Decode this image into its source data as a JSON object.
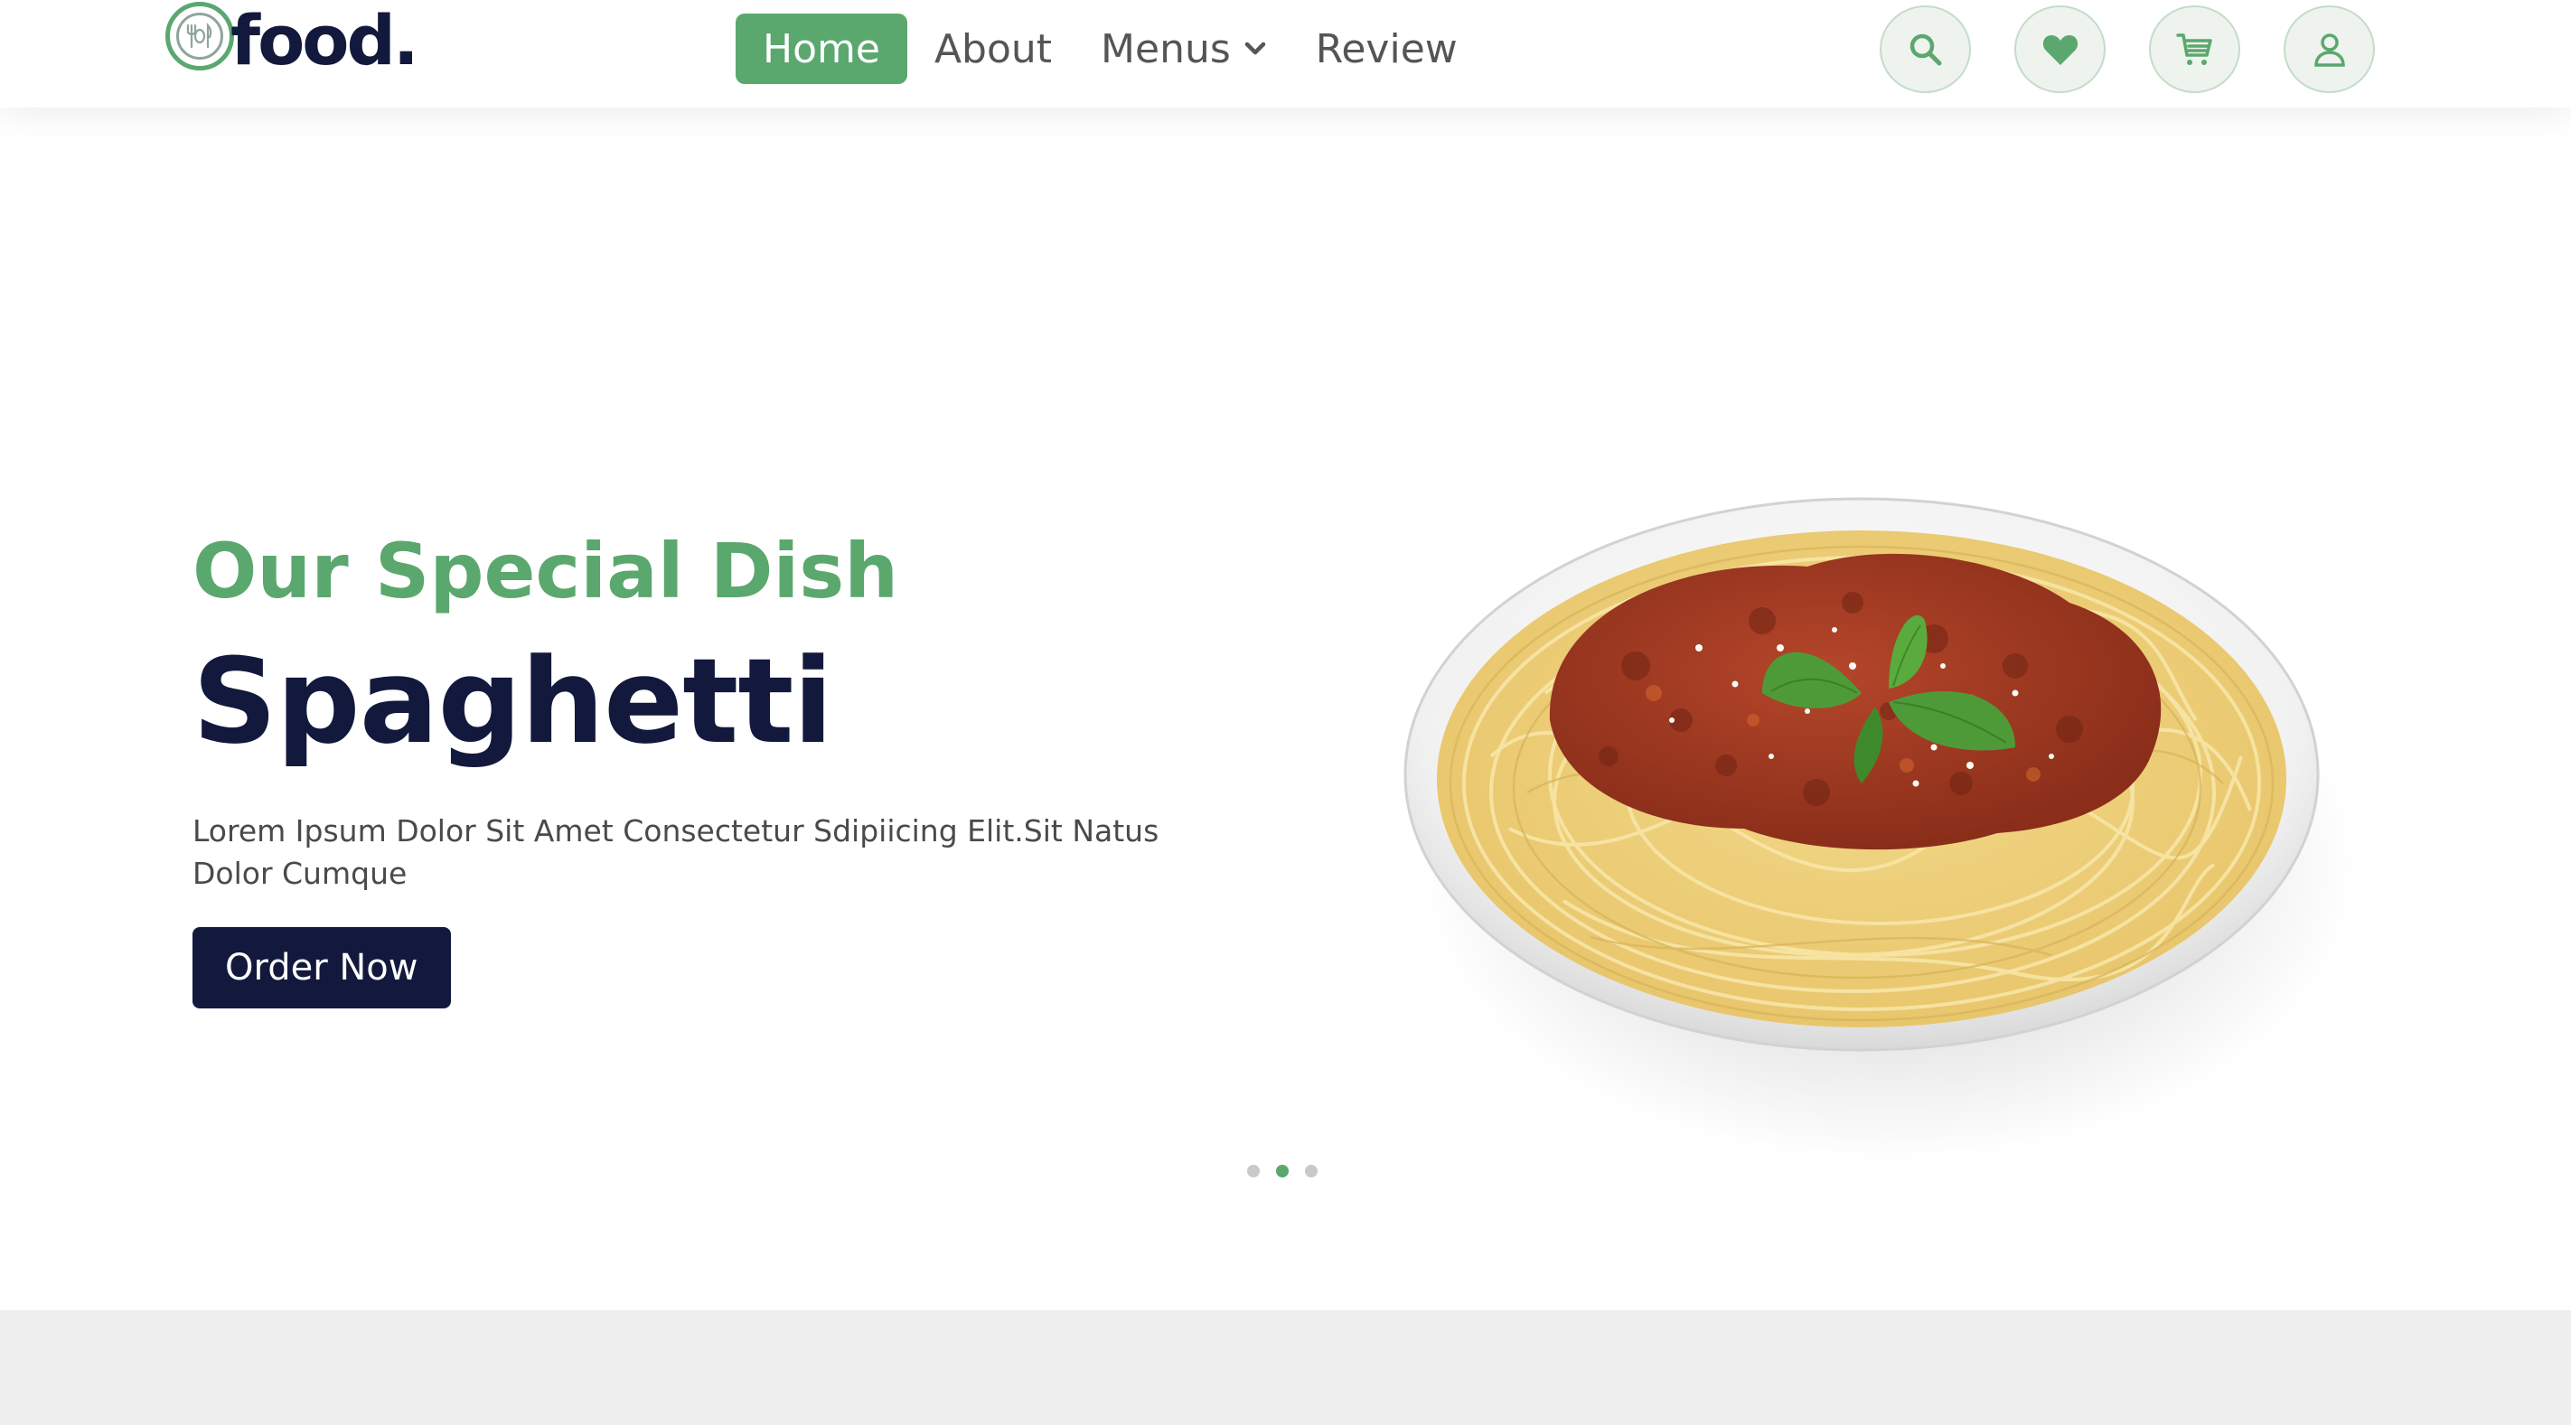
{
  "brand": {
    "name": "food.",
    "logo_icon": "plate-fork-knife-icon",
    "accent_color": "#5aa86e",
    "dark_color": "#13193d"
  },
  "nav": {
    "items": [
      {
        "label": "Home",
        "active": true
      },
      {
        "label": "About",
        "active": false
      },
      {
        "label": "Menus",
        "active": false,
        "dropdown": true
      },
      {
        "label": "Review",
        "active": false
      }
    ]
  },
  "header_icons": [
    "search-icon",
    "heart-icon",
    "cart-icon",
    "user-icon"
  ],
  "hero": {
    "subtitle": "Our Special Dish",
    "title": "Spaghetti",
    "description": "Lorem Ipsum Dolor Sit Amet Consectetur Sdipiicing Elit.Sit Natus Dolor Cumque",
    "cta_label": "Order Now",
    "image": "spaghetti-plate",
    "slider": {
      "total": 3,
      "active": 2
    }
  }
}
